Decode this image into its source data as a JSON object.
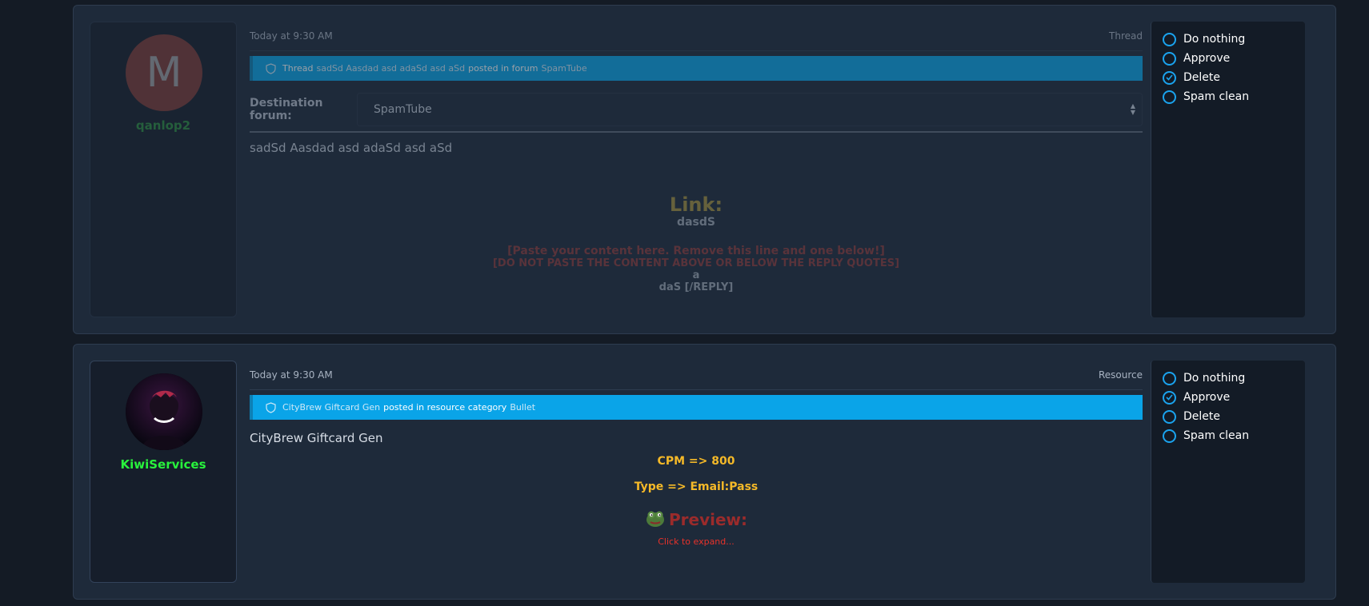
{
  "items": [
    {
      "avatar_letter": "M",
      "username": "qanlop2",
      "time": "Today at 9:30 AM",
      "type": "Thread",
      "banner": {
        "prefix": "Thread",
        "title": "sadSd Aasdad asd adaSd asd aSd",
        "middle": "posted in forum",
        "location": "SpamTube"
      },
      "destination_label": "Destination forum:",
      "destination_value": "SpamTube",
      "title": "sadSd Aasdad asd adaSd asd aSd",
      "body": {
        "link_heading": "Link:",
        "link_value": "dasdS",
        "paste_line1": "[Paste your content here. Remove this line and one below!]",
        "paste_line2": "[DO NOT PASTE THE CONTENT ABOVE OR BELOW THE REPLY QUOTES]",
        "line_a": "a",
        "line_reply": "daS [/REPLY]"
      },
      "actions": [
        "Do nothing",
        "Approve",
        "Delete",
        "Spam clean"
      ],
      "selected_action": "Delete"
    },
    {
      "username": "KiwiServices",
      "time": "Today at 9:30 AM",
      "type": "Resource",
      "banner": {
        "title": "CityBrew Giftcard Gen",
        "middle": "posted in resource category",
        "location": "Bullet"
      },
      "title": "CityBrew Giftcard Gen",
      "body": {
        "cpm": "CPM => 800",
        "type_line": "Type => Email:Pass",
        "preview": "Preview:",
        "expand": "Click to expand..."
      },
      "actions": [
        "Do nothing",
        "Approve",
        "Delete",
        "Spam clean"
      ],
      "selected_action": "Approve"
    }
  ],
  "colors": {
    "accent": "#0aa4e8",
    "radio": "#1aa3ee",
    "username1": "#2b8a3e",
    "username2": "#28f23c",
    "highlight": "#f5b928",
    "alert": "#e8322a"
  }
}
